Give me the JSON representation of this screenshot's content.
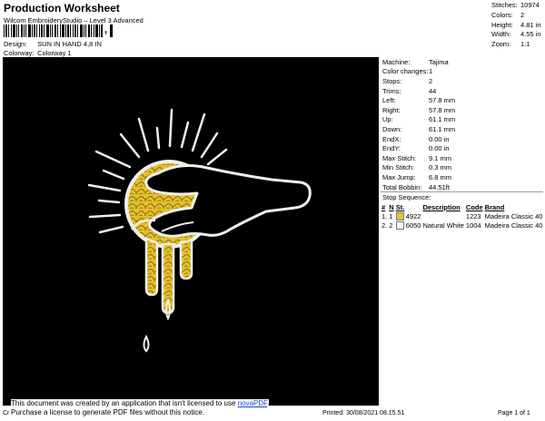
{
  "header": {
    "title": "Production Worksheet",
    "subtitle": "Wilcom EmbroideryStudio – Level 3 Advanced",
    "barcode_suffix": ","
  },
  "info": [
    {
      "key": "Design:",
      "value": "SUN IN HAND 4,8 IN"
    },
    {
      "key": "Colorway:",
      "value": "Colorway 1"
    }
  ],
  "stats": [
    {
      "key": "Stitches:",
      "value": "10974"
    },
    {
      "key": "Colors:",
      "value": "2"
    },
    {
      "key": "Height:",
      "value": "4.81 in"
    },
    {
      "key": "Width:",
      "value": "4.55 in"
    },
    {
      "key": "Zoom:",
      "value": "1:1"
    }
  ],
  "machine": [
    {
      "key": "Machine:",
      "value": "Tajima"
    },
    {
      "key": "Color changes:",
      "value": "1"
    },
    {
      "key": "Stops:",
      "value": "2"
    },
    {
      "key": "Trims:",
      "value": "44"
    },
    {
      "key": "Left:",
      "value": "57.8 mm"
    },
    {
      "key": "Right:",
      "value": "57.8 mm"
    },
    {
      "key": "Up:",
      "value": "61.1 mm"
    },
    {
      "key": "Down:",
      "value": "61.1 mm"
    },
    {
      "key": "EndX:",
      "value": "0.00 in"
    },
    {
      "key": "EndY:",
      "value": "0.00 in"
    },
    {
      "key": "Max Stitch:",
      "value": "9.1 mm"
    },
    {
      "key": "Min Stitch:",
      "value": "0.3 mm"
    },
    {
      "key": "Max Jump:",
      "value": "6.8 mm"
    },
    {
      "key": "Total Bobbin:",
      "value": "44.51ft"
    }
  ],
  "stop_sequence": {
    "title": "Stop Sequence:",
    "headers": [
      "#",
      "N",
      "St.",
      "Description",
      "Code",
      "Brand"
    ],
    "rows": [
      {
        "n": "1.",
        "stop": "1",
        "swatch": "#e8c53a",
        "st": "4922",
        "desc": "",
        "code": "1223",
        "brand": "Madeira Classic 40"
      },
      {
        "n": "2.",
        "stop": "2",
        "swatch": "#f4f4f2",
        "st": "6050",
        "desc": "Natural White",
        "code": "1004",
        "brand": "Madeira Classic 40"
      }
    ]
  },
  "notice": {
    "line1": "This document was created by an application that isn't licensed to use",
    "link": "novaPDF",
    "line1_end": ".",
    "line2": "Purchase a license to generate PDF files without this notice."
  },
  "footer": {
    "left": "Cr",
    "printed": "Printed: 30/08/2021 08.15.51",
    "page": "Page 1 of 1"
  },
  "colors": {
    "gold": "#e3c02d",
    "gold_dark": "#8a6a0e",
    "thread_white": "#f1f1ec",
    "canvas": "#000000"
  }
}
